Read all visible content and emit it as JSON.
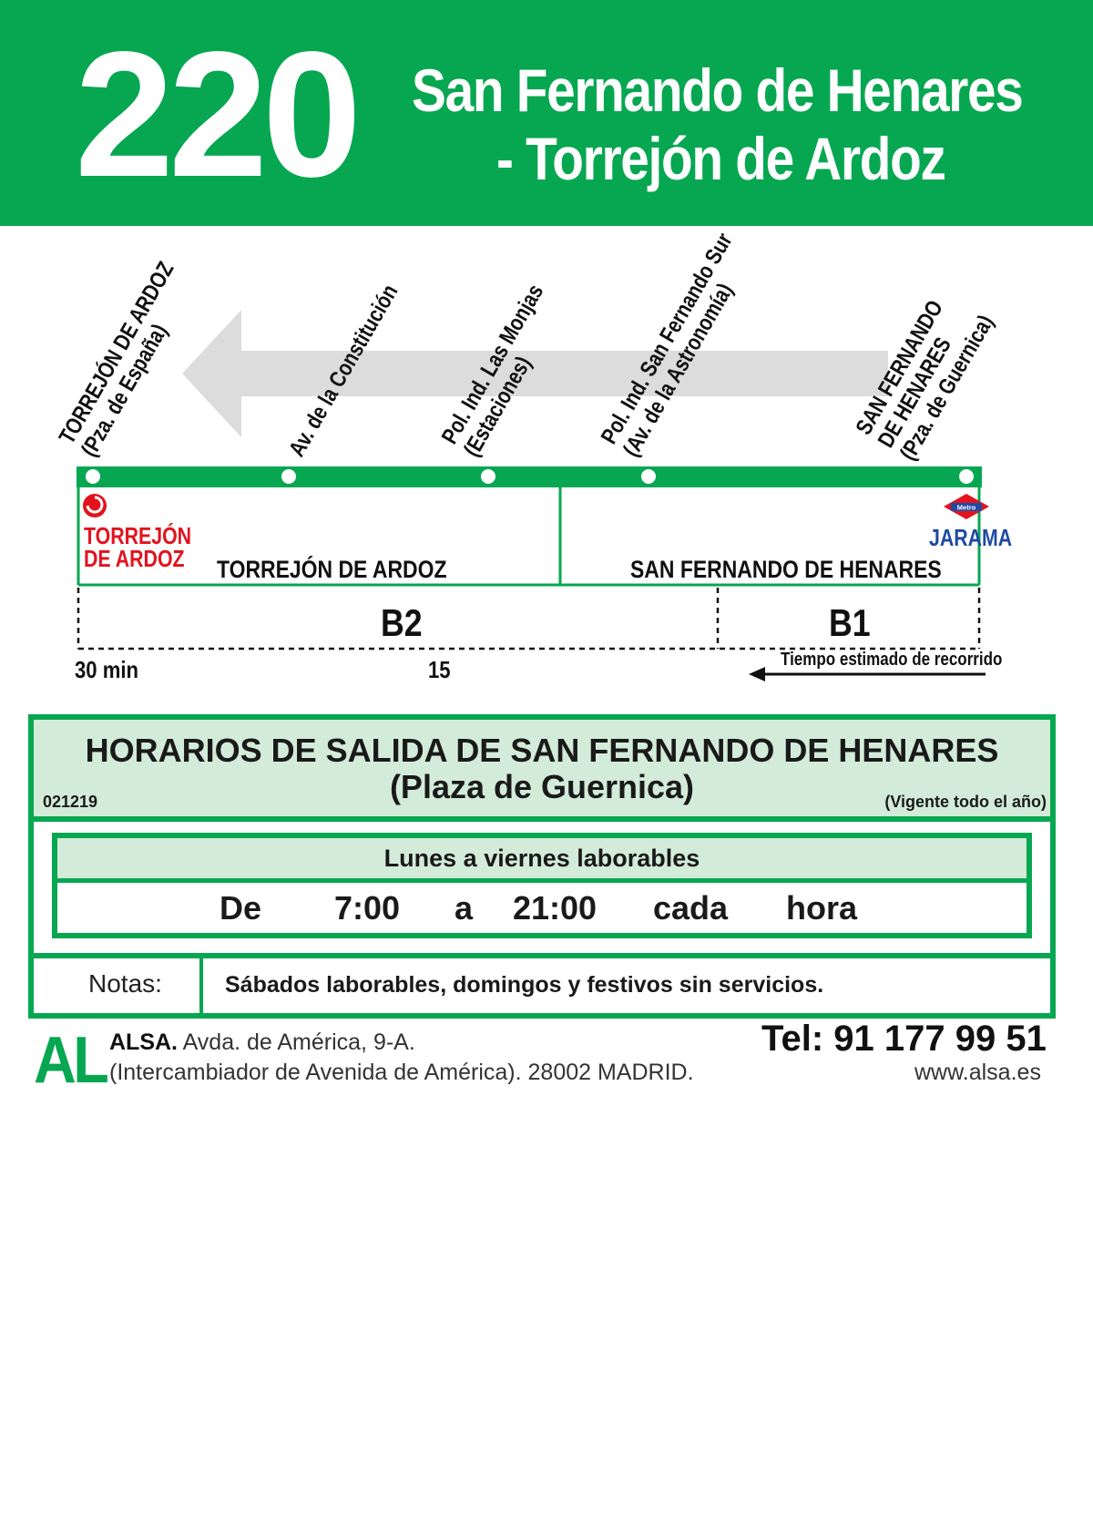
{
  "header": {
    "route_number": "220",
    "route_name_line1": "San Fernando de Henares",
    "route_name_line2": "- Torrejón de Ardoz"
  },
  "route_diagram": {
    "stops": [
      {
        "name_line1": "TORREJÓN DE ARDOZ",
        "name_line2": "(Pza. de España)"
      },
      {
        "name_line1": "Av. de la Constitución",
        "name_line2": ""
      },
      {
        "name_line1": "Pol. Ind. Las Monjas",
        "name_line2": "(Estaciones)"
      },
      {
        "name_line1": "Pol. Ind. San Fernando Sur",
        "name_line2": "(Av. de la Astronomía)"
      },
      {
        "name_line1": "SAN FERNANDO",
        "name_line2": "DE HENARES",
        "name_line3": "(Pza. de Guernica)"
      }
    ],
    "torrejon_station": {
      "line1": "TORREJÓN",
      "line2": "DE ARDOZ"
    },
    "metro_badge": "Metro",
    "jarama_station": "JARAMA",
    "zones": [
      "TORREJÓN DE ARDOZ",
      "SAN FERNANDO DE HENARES"
    ],
    "fare_zones": [
      "B2",
      "B1"
    ],
    "time_labels": [
      "30 min",
      "15"
    ],
    "travel_time_note": "Tiempo estimado de recorrido",
    "colors": {
      "route_line": "#07a752",
      "direction_arrow": "#dcdcdc",
      "renfe_red": "#e2131d",
      "metro_blue": "#1f4aa3"
    }
  },
  "schedule": {
    "title": "HORARIOS DE SALIDA DE SAN FERNANDO DE HENARES",
    "subtitle": "(Plaza de Guernica)",
    "id": "021219",
    "validity": "(Vigente todo el año)",
    "weekday": {
      "label": "Lunes a viernes laborables",
      "words": {
        "from": "De",
        "start": "7:00",
        "to": "a",
        "end": "21:00",
        "every": "cada",
        "unit": "hora"
      }
    },
    "notes_label": "Notas:",
    "notes_text": "Sábados laborables, domingos y festivos sin servicios."
  },
  "footer": {
    "logo": "AL",
    "company": "ALSA.",
    "address_line1": "Avda. de América, 9-A.",
    "address_line2": "(Intercambiador de Avenida de América). 28002 MADRID.",
    "phone": "Tel: 91 177 99 51",
    "website": "www.alsa.es"
  },
  "brand_color": "#07a752"
}
